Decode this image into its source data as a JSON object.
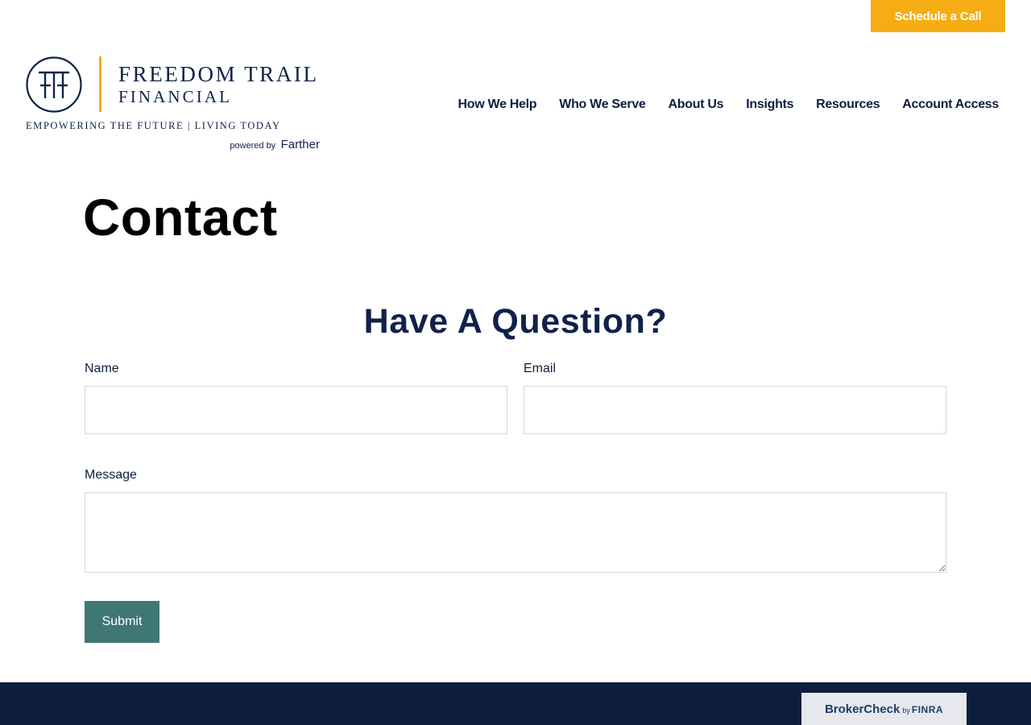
{
  "header": {
    "cta_label": "Schedule a Call",
    "logo": {
      "name_line1": "FREEDOM TRAIL",
      "name_line2": "FINANCIAL",
      "tagline": "EMPOWERING THE FUTURE | LIVING TODAY",
      "powered_by": "powered by",
      "partner": "Farther",
      "monogram_icon": "ftf-monogram-icon"
    },
    "nav": [
      {
        "label": "How We Help"
      },
      {
        "label": "Who We Serve"
      },
      {
        "label": "About Us"
      },
      {
        "label": "Insights"
      },
      {
        "label": "Resources"
      },
      {
        "label": "Account Access"
      }
    ]
  },
  "page": {
    "title": "Contact"
  },
  "form": {
    "heading": "Have A Question?",
    "name_label": "Name",
    "name_value": "",
    "email_label": "Email",
    "email_value": "",
    "message_label": "Message",
    "message_value": "",
    "submit_label": "Submit"
  },
  "footer": {
    "brokercheck": {
      "brand": "BrokerCheck",
      "by": "by",
      "org": "FINRA"
    }
  },
  "colors": {
    "accent": "#f6ad14",
    "navy": "#0e1e3e",
    "submit": "#3f7774"
  }
}
